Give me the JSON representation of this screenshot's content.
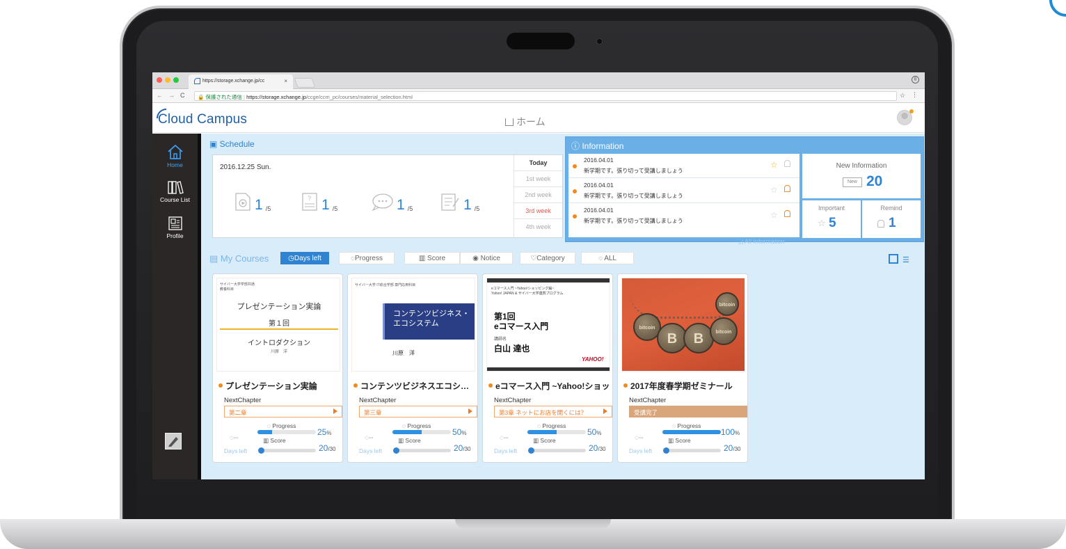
{
  "browser": {
    "tab_title": "https://storage.xchange.jp/cc",
    "tab_close": "×",
    "nav": {
      "back": "←",
      "forward": "→",
      "reload": "C"
    },
    "secure_label": "🔒 保護された通信",
    "url_host": "https://storage.xchange.jp",
    "url_path": "/ccge/ccm_pc/courses/material_selection.html",
    "bookmark_star": "☆",
    "menu": "⋮",
    "profile_icon": "θ",
    "window_dots": [
      "#ff5f57",
      "#febc2e",
      "#28c840"
    ]
  },
  "app": {
    "logo": "Cloud Campus",
    "home_label": "ホーム"
  },
  "sidebar": {
    "items": [
      {
        "label": "Home",
        "icon": "home-icon",
        "active": true
      },
      {
        "label": "Course List",
        "icon": "books-icon",
        "active": false
      },
      {
        "label": "Profile",
        "icon": "profile-card-icon",
        "active": false
      }
    ]
  },
  "schedule": {
    "title": "Schedule",
    "date": "2016.12.25 Sun.",
    "stats": [
      {
        "icon": "video-icon",
        "value": "1",
        "total": "/5"
      },
      {
        "icon": "quiz-icon",
        "value": "1",
        "total": "/5"
      },
      {
        "icon": "chat-icon",
        "value": "1",
        "total": "/5"
      },
      {
        "icon": "report-icon",
        "value": "1",
        "total": "/5"
      }
    ],
    "weeks": [
      "Today",
      "1st week",
      "2nd week",
      "3rd week",
      "4th week"
    ]
  },
  "information": {
    "title": "Information",
    "items": [
      {
        "date": "2016.04.01",
        "message": "新学期です。張り切って受講しましょう",
        "starred": true,
        "remind": false
      },
      {
        "date": "2016.04.01",
        "message": "新学期です。張り切って受講しましょう",
        "starred": false,
        "remind": true
      },
      {
        "date": "2016.04.01",
        "message": "新学期です。張り切って受講しましょう",
        "starred": false,
        "remind": true
      }
    ],
    "all_link": "All Information",
    "new_title": "New Information",
    "new_badge": "New",
    "new_count": "20",
    "important_title": "Important",
    "important_count": "5",
    "remind_title": "Remind",
    "remind_count": "1"
  },
  "courses": {
    "title": "My Courses",
    "filters": [
      "Days left",
      "Progress",
      "Score",
      "Notice",
      "Category",
      "ALL"
    ],
    "next_label": "NextChapter",
    "progress_label": "Progress",
    "score_label": "Score",
    "days_label": "Days left",
    "days_value": "--",
    "items": [
      {
        "title": "プレゼンテーション実論",
        "next_chapter": "第二章",
        "progress": 25,
        "progress_text": "25",
        "score": "20",
        "score_total": "/30",
        "done": false,
        "thumb": {
          "caption": "サイバー大学学部共通\n教養科目",
          "title": "プレゼンテーション実論",
          "episode": "第１回",
          "subtitle": "イントロダクション",
          "author": "川原　洋"
        }
      },
      {
        "title": "コンテンツビジネスエコシステム",
        "next_chapter": "第三章",
        "progress": 50,
        "progress_text": "50",
        "score": "20",
        "score_total": "/30",
        "done": false,
        "thumb": {
          "caption": "サイバー大学 IT総合学部 専門応用科目",
          "band": "コンテンツビジネス・\nエコシステム",
          "author": "川原　洋"
        }
      },
      {
        "title": "eコマース入門 ~Yahoo!ショッピング編~",
        "next_chapter": "第3章 ネットにお店を開くには？",
        "progress": 50,
        "progress_text": "50",
        "score": "20",
        "score_total": "/30",
        "done": false,
        "thumb": {
          "caption": "eコマース入門 ~Yahoo!ショッピング編~\nYahoo! JAPAN & サイバー大学連携プログラム",
          "episode": "第1回\neコマース入門",
          "lecturer_label": "講師名",
          "lecturer": "白山 達也",
          "brand": "YAHOO!"
        }
      },
      {
        "title": "2017年度春学期ゼミナール",
        "next_chapter": "受講完了",
        "progress": 100,
        "progress_text": "100",
        "score": "20",
        "score_total": "/30",
        "done": true,
        "thumb": {
          "coin_text": "bitcoin",
          "coin_letter": "B"
        }
      }
    ]
  },
  "colors": {
    "accent": "#2f83d1",
    "orange": "#f28a1e",
    "sidebar": "#2b2726",
    "panel": "#d8ecfa"
  }
}
